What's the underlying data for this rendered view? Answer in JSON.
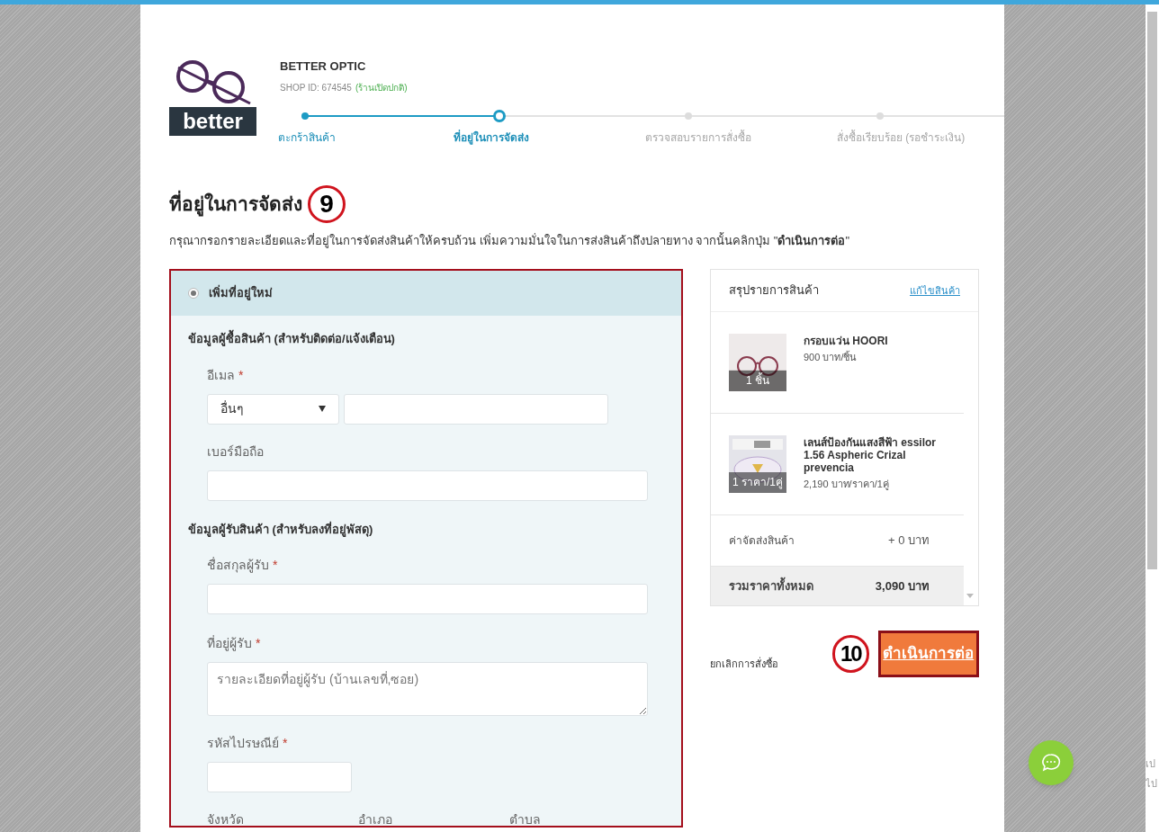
{
  "shop": {
    "name": "BETTER OPTIC",
    "logo_text": "better",
    "shop_id": "SHOP ID: 674545",
    "status": "(ร้านเปิดปกติ)"
  },
  "steps": [
    {
      "label": "ตะกร้าสินค้า",
      "completed": true,
      "selected": false
    },
    {
      "label": "ที่อยู่ในการจัดส่ง",
      "completed": false,
      "selected": true
    },
    {
      "label": "ตรวจสอบรายการสั่งซื้อ",
      "completed": false,
      "selected": false
    },
    {
      "label": "สั่งซื้อเรียบร้อย (รอชำระเงิน)",
      "completed": false,
      "selected": false
    }
  ],
  "heading": "ที่อยู่ในการจัดส่ง",
  "heading_badge": "9",
  "intro": "กรุณากรอกรายละเอียดและที่อยู่ในการจัดส่งสินค้าให้ครบถ้วน เพิ่มความมั่นใจในการส่งสินค้าถึงปลายทาง จากนั้นคลิกปุ่ม \"**ดำเนินการต่อ**\"",
  "address_option": {
    "label": "เพิ่มที่อยู่ใหม่",
    "selected": true
  },
  "sections": [
    {
      "title": "ข้อมูลผู้ซื้อสินค้า (สำหรับติดต่อ/แจ้งเตือน)",
      "fields": [
        {
          "kind": "email",
          "label": "อีเมล",
          "required_mark": "*",
          "select_value": "อื่นๆ"
        },
        {
          "kind": "text",
          "label": "เบอร์มือถือ"
        }
      ]
    },
    {
      "title": "ข้อมูลผู้รับสินค้า (สำหรับลงที่อยู่พัสดุ)",
      "fields": [
        {
          "kind": "text",
          "label": "ชื่อสกุลผู้รับ",
          "required_mark": "*"
        },
        {
          "kind": "textarea",
          "label": "ที่อยู่ผู้รับ",
          "required_mark": "*",
          "placeholder": "รายละเอียดที่อยู่ผู้รับ (บ้านเลขที่,ซอย)"
        },
        {
          "kind": "short",
          "label": "รหัสไปรษณีย์",
          "required_mark": "*"
        },
        {
          "kind": "columns",
          "labels": [
            "จังหวัด",
            "อำเภอ",
            "ตำบล"
          ]
        }
      ]
    }
  ],
  "summary": {
    "title": "สรุปรายการสินค้า",
    "edit_link": "แก้ไขสินค้า",
    "items": [
      {
        "kind": "frame",
        "name": "กรอบแว่น HOORI",
        "price": "900 บาท/ชิ้น",
        "qty": "1 ชิ้น"
      },
      {
        "kind": "lens",
        "name": "เลนส์ป้องกันแสงสีฟ้า essilor 1.56 Aspheric Crizal prevencia",
        "price": "2,190 บาท/ราคา/1คู่",
        "qty": "1 ราคา/1คู่"
      }
    ],
    "shipping_label": "ค่าจัดส่งสินค้า",
    "shipping_value": "+ 0 บาท",
    "total_label": "รวมราคาทั้งหมด",
    "total_value": "3,090 บาท"
  },
  "cancel_link": "ยกเลิกการสั่งซื้อ",
  "continue_badge": "10",
  "continue_button": "ดำเนินการต่อ",
  "edge_texts": [
    "เป",
    "ไป"
  ]
}
